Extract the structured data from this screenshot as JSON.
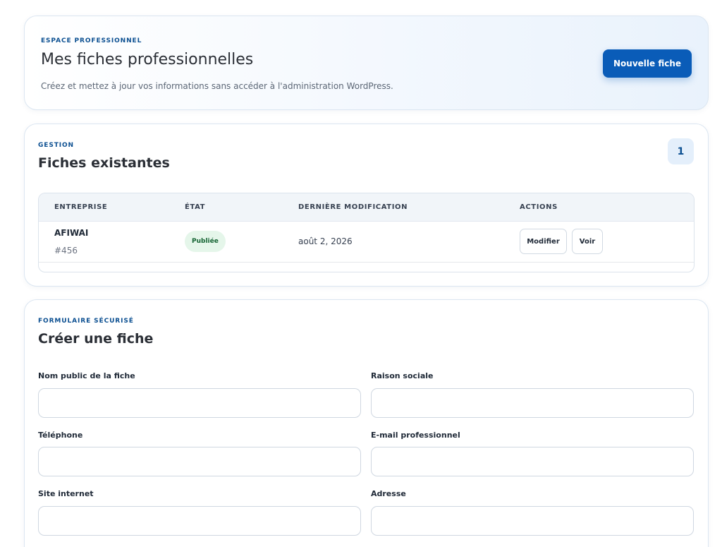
{
  "hero": {
    "eyebrow": "ESPACE PROFESSIONNEL",
    "title": "Mes fiches professionnelles",
    "subtitle": "Créez et mettez à jour vos informations sans accéder à l'administration WordPress.",
    "new_button": "Nouvelle fiche"
  },
  "management": {
    "eyebrow": "GESTION",
    "title": "Fiches existantes",
    "count": "1",
    "columns": [
      "ENTREPRISE",
      "ÉTAT",
      "DERNIÈRE MODIFICATION",
      "ACTIONS"
    ],
    "rows": [
      {
        "company": "AFIWAI",
        "id": "#456",
        "status": "Publiée",
        "modified": "août 2, 2026",
        "edit_label": "Modifier",
        "view_label": "Voir"
      }
    ]
  },
  "form": {
    "eyebrow": "FORMULAIRE SÉCURISÉ",
    "title": "Créer une fiche",
    "fields": {
      "public_name": {
        "label": "Nom public de la fiche",
        "value": ""
      },
      "company_name": {
        "label": "Raison sociale",
        "value": ""
      },
      "phone": {
        "label": "Téléphone",
        "value": ""
      },
      "email": {
        "label": "E-mail professionnel",
        "value": ""
      },
      "website": {
        "label": "Site internet",
        "value": ""
      },
      "address": {
        "label": "Adresse",
        "value": ""
      }
    }
  },
  "colors": {
    "primary": "#0a5cb8",
    "accent_text": "#0b4f91",
    "status_published_bg": "#e5f6ea",
    "status_published_text": "#166534"
  }
}
